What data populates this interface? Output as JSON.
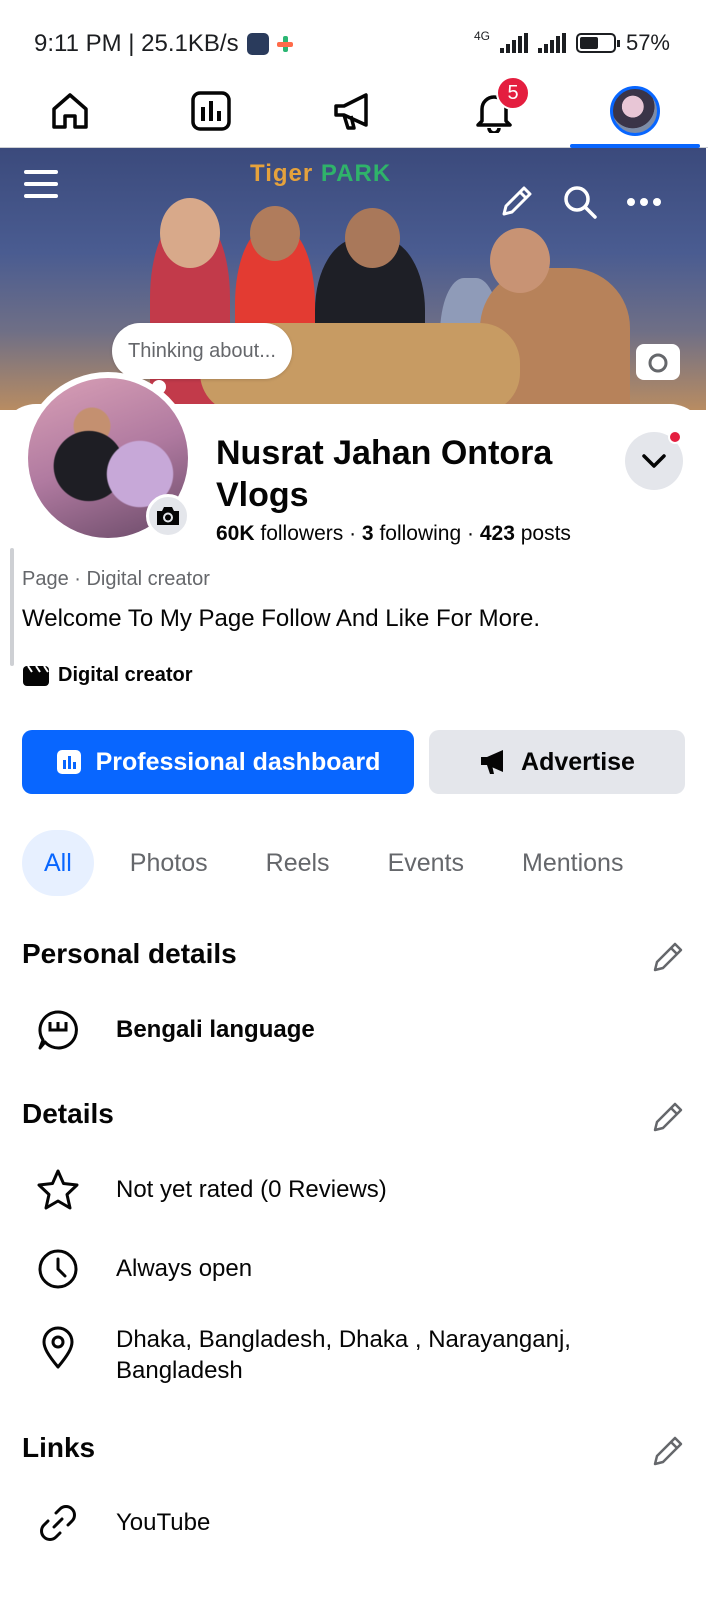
{
  "status_bar": {
    "time_speed": "9:11 PM | 25.1KB/s",
    "network": "4G",
    "battery": "57%"
  },
  "nav": {
    "notification_count": "5",
    "active_tab": "profile"
  },
  "cover": {
    "sign_text_a": "Tiger",
    "sign_text_b": "PARK",
    "thinking_placeholder": "Thinking about..."
  },
  "profile": {
    "name": "Nusrat Jahan Ontora Vlogs",
    "followers_count": "60K",
    "followers_label": "followers",
    "following_count": "3",
    "following_label": "following",
    "posts_count": "423",
    "posts_label": "posts",
    "category": "Page · Digital creator",
    "bio": "Welcome To My Page Follow And Like For More.",
    "creator_label": "Digital creator"
  },
  "actions": {
    "dashboard_label": "Professional dashboard",
    "advertise_label": "Advertise"
  },
  "tabs": [
    {
      "label": "All",
      "active": true
    },
    {
      "label": "Photos"
    },
    {
      "label": "Reels"
    },
    {
      "label": "Events"
    },
    {
      "label": "Mentions"
    }
  ],
  "personal_details": {
    "title": "Personal details",
    "items": [
      {
        "icon": "speech-bubble-icon",
        "text": "Bengali language"
      }
    ]
  },
  "details": {
    "title": "Details",
    "items": [
      {
        "icon": "star-icon",
        "text": "Not yet rated (0 Reviews)"
      },
      {
        "icon": "clock-icon",
        "text": "Always open"
      },
      {
        "icon": "location-pin-icon",
        "text": "Dhaka, Bangladesh, Dhaka , Narayanganj,",
        "text2": "Bangladesh"
      }
    ]
  },
  "links": {
    "title": "Links",
    "items": [
      {
        "icon": "link-icon",
        "text": "YouTube"
      }
    ]
  },
  "colors": {
    "accent": "#0866ff",
    "badge": "#e41e3f",
    "secondary_text": "#65676b"
  }
}
